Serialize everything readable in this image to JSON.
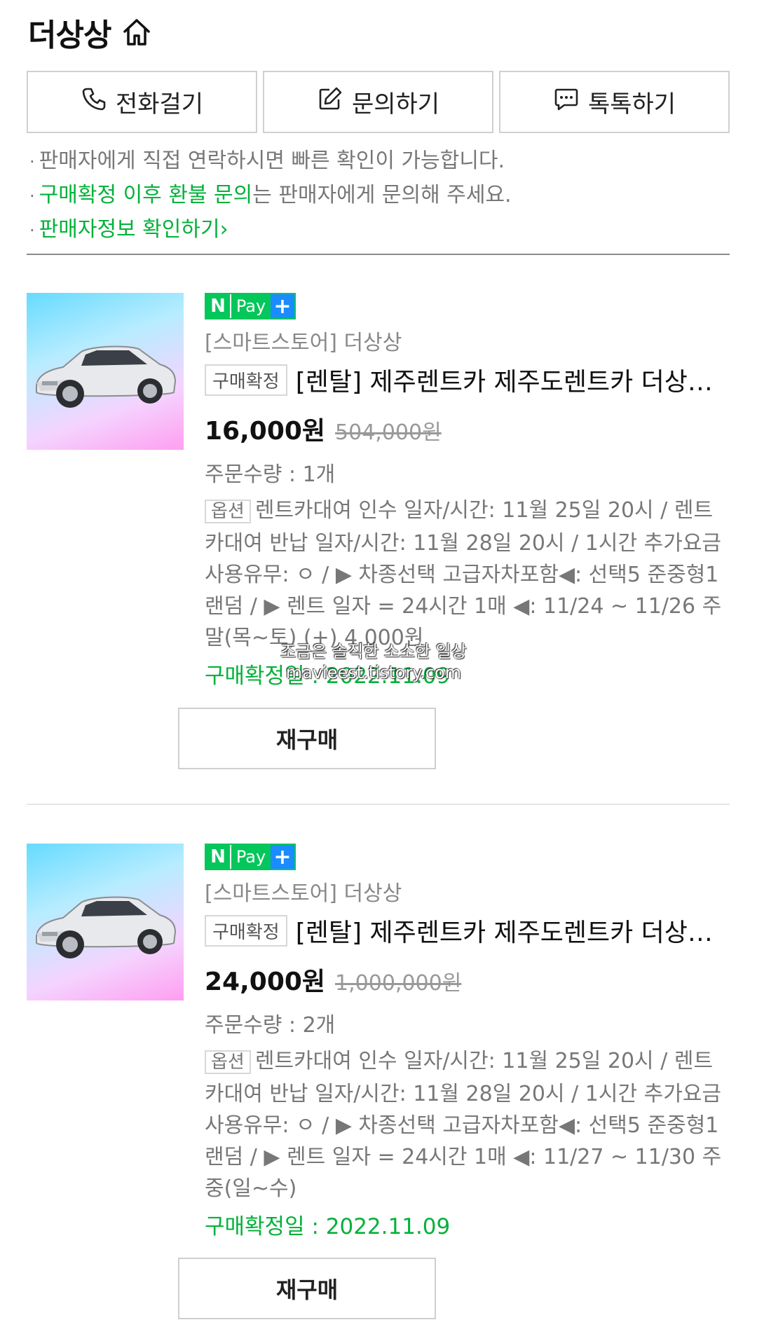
{
  "store": {
    "name": "더상상",
    "home_icon": "home-icon"
  },
  "contact_buttons": [
    {
      "label": "전화걸기",
      "icon": "phone-icon"
    },
    {
      "label": "문의하기",
      "icon": "edit-icon"
    },
    {
      "label": "톡톡하기",
      "icon": "chat-icon"
    }
  ],
  "notes": {
    "line1": "판매자에게 직접 연락하시면 빠른 확인이 가능합니다.",
    "line2_green": "구매확정 이후 환불 문의",
    "line2_rest": "는 판매자에게 문의해 주세요.",
    "line3_link": "판매자정보 확인하기"
  },
  "colors": {
    "accent_green": "#03b13a",
    "npay_green": "#03c75a",
    "npay_blue": "#1a8cff"
  },
  "orders": [
    {
      "npay": {
        "n": "N",
        "pay": "Pay",
        "plus": "+"
      },
      "seller": "[스마트스토어] 더상상",
      "status": "구매확정",
      "title": "[렌탈] 제주렌트카 제주도렌트카 더상상 고급자차포함",
      "price": "16,000원",
      "original_price": "504,000원",
      "quantity": "주문수량 : 1개",
      "option_tag": "옵션",
      "option_text": "렌트카대여 인수 일자/시간: 11월 25일 20시 / 렌트카대여 반납 일자/시간: 11월 28일 20시 / 1시간 추가요금 사용유무: ㅇ / ▶ 차종선택 고급자차포함◀: 선택5 준중형1 랜덤 / ▶ 렌트 일자 = 24시간 1매 ◀: 11/24 ~ 11/26 주말(목~토) (+) 4,000원",
      "confirm_date": "구매확정일 : 2022.11.09",
      "rebuy_label": "재구매"
    },
    {
      "npay": {
        "n": "N",
        "pay": "Pay",
        "plus": "+"
      },
      "seller": "[스마트스토어] 더상상",
      "status": "구매확정",
      "title": "[렌탈] 제주렌트카 제주도렌트카 더상상 고급자차포함",
      "price": "24,000원",
      "original_price": "1,000,000원",
      "quantity": "주문수량 : 2개",
      "option_tag": "옵션",
      "option_text": "렌트카대여 인수 일자/시간: 11월 25일 20시 / 렌트카대여 반납 일자/시간: 11월 28일 20시 / 1시간 추가요금 사용유무: ㅇ / ▶ 차종선택 고급자차포함◀: 선택5 준중형1 랜덤 / ▶ 렌트 일자 = 24시간 1매 ◀: 11/27 ~ 11/30 주중(일~수)",
      "confirm_date": "구매확정일 : 2022.11.09",
      "rebuy_label": "재구매"
    }
  ],
  "watermark": {
    "line1": "조금은 솔직한 소소한 일상",
    "line2": "mavieest.tistory.com"
  }
}
